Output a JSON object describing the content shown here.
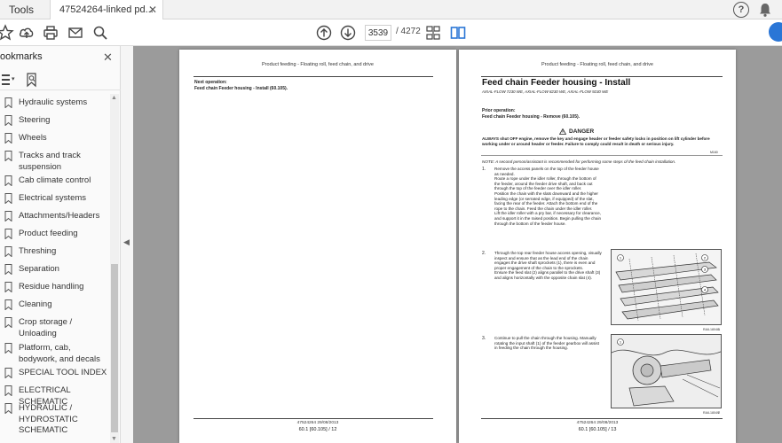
{
  "tabs": {
    "tools": "Tools",
    "document": "47524264-linked pd...",
    "close": "✕"
  },
  "topbar": {
    "help_icon": "help-icon",
    "bell_icon": "bell-icon",
    "help_glyph": "?"
  },
  "toolbar": {
    "icons": [
      "star-icon",
      "upload-icon",
      "print-icon",
      "mail-icon",
      "zoom-icon",
      "page-up-icon",
      "page-down-icon",
      "page-layout-icon",
      "two-page-icon"
    ],
    "page_current": "3539",
    "page_total": "/ 4272",
    "accent": "#2a76d6"
  },
  "sidebar": {
    "title": "ookmarks",
    "close": "✕",
    "items": [
      {
        "label": "Hydraulic systems"
      },
      {
        "label": "Steering"
      },
      {
        "label": "Wheels"
      },
      {
        "label": "Tracks and track suspension"
      },
      {
        "label": "Cab climate control"
      },
      {
        "label": "Electrical systems"
      },
      {
        "label": "Attachments/Headers"
      },
      {
        "label": "Product feeding"
      },
      {
        "label": "Threshing"
      },
      {
        "label": "Separation"
      },
      {
        "label": "Residue handling"
      },
      {
        "label": "Cleaning"
      },
      {
        "label": "Crop storage / Unloading"
      },
      {
        "label": "Platform, cab, bodywork, and decals"
      },
      {
        "label": "SPECIAL TOOL INDEX"
      },
      {
        "label": "ELECTRICAL SCHEMATIC"
      },
      {
        "label": "HYDRAULIC / HYDROSTATIC SCHEMATIC"
      }
    ]
  },
  "pages": {
    "left": {
      "header": "Product feeding - Floating roll, feed chain, and drive",
      "next_op_label": "Next operation:",
      "next_op_text": "Feed chain Feeder housing - Install (60.105).",
      "footer_code": "47524264 29/08/2013",
      "footer_page": "60.1 [60.105] / 12"
    },
    "right": {
      "header": "Product feeding - Floating roll, feed chain, and drive",
      "title": "Feed chain Feeder housing - Install",
      "models": "AXIAL-FLOW 7230 WE, AXIAL-FLOW 8230 WE, AXIAL-FLOW 9230 WE",
      "prior_op_label": "Prior operation:",
      "prior_op_text": "Feed chain Feeder housing - Remove (60.105).",
      "danger_label": "DANGER",
      "danger_text": "ALWAYS shut OFF engine, remove the key and engage header or feeder safety locks in position on lift cylinder before working under or around header or feeder. Failure to comply could result in death or serious injury.",
      "danger_code": "M160",
      "note": "NOTE: A second person/assistant is recommended for performing some steps of the feed chain installation.",
      "step1_num": "1.",
      "step1_a": "Remove the access panels on the top of the feeder house as needed.",
      "step1_b": "Route a rope under the idler roller, through the bottom of the feeder, around the feeder drive shaft, and back out through the top of the feeder over the idler roller.",
      "step1_c": "Position the chain with the slats downward and the higher leading edge (or serrated edge, if equipped) of the slat, facing the rear of the feeder. Attach the bottom end of the rope to the chain. Feed the chain under the idler roller.",
      "step1_d": "Lift the idler roller with a pry bar, if necessary for clearance, and support it in the raised position. Begin pulling the chain through the bottom of the feeder house.",
      "step2_num": "2.",
      "step2_a": "Through the top rear feeder house access opening, visually inspect and ensure that as the lead end of the chain engages the drive shaft sprockets (1), there is even and proper engagement of the chain to the sprockets.",
      "step2_b": "Ensure the feed slat (2) aligns parallel to the drive shaft (3) and aligns horizontally with the opposite chain slat (4).",
      "fig1_code": "RAIL18048",
      "fig1_num": "1",
      "step3_num": "3.",
      "step3_a": "Continue to pull the chain through the housing. Manually rotating the input shaft (1) of the feeder gearbox will assist in feeding the chain through the housing.",
      "fig2_code": "RAIL18049",
      "fig2_num": "2",
      "footer_code": "47524264 29/08/2013",
      "footer_page": "60.1 [60.105] / 13"
    }
  }
}
